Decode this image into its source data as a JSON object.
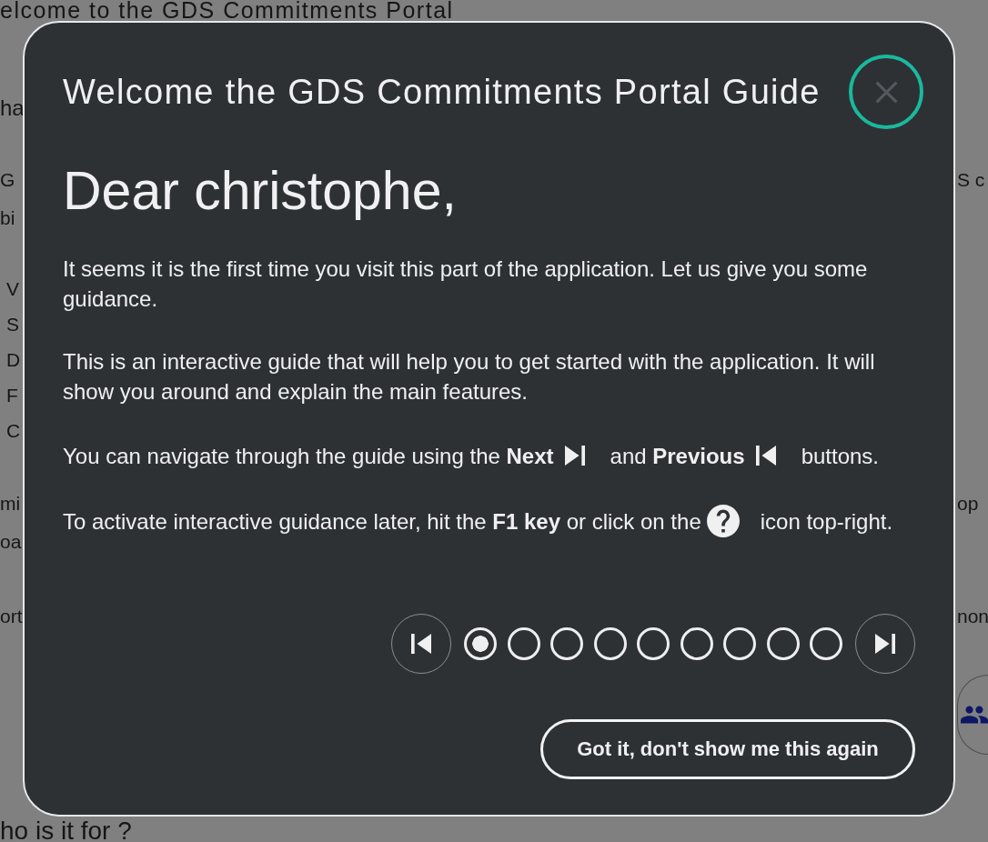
{
  "background_page": {
    "title": "elcome to the GDS Commitments Portal",
    "blocks": [
      {
        "kind": "heading",
        "left": "ha"
      },
      {
        "kind": "paragraph",
        "lines": [
          {
            "left": "G",
            "right": "S c"
          },
          {
            "left": "bi"
          }
        ]
      },
      {
        "kind": "list",
        "items": [
          "V",
          "S",
          "D",
          "F",
          "C"
        ]
      },
      {
        "kind": "paragraph",
        "lines": [
          {
            "left": "mi",
            "right": "op"
          },
          {
            "left": "oa"
          }
        ]
      },
      {
        "kind": "paragraph",
        "lines": [
          {
            "left": "ort",
            "right": "non"
          }
        ]
      },
      {
        "kind": "button"
      },
      {
        "kind": "heading",
        "left": "ho is it for ?"
      }
    ]
  },
  "guide": {
    "title": "Welcome the GDS Commitments Portal Guide",
    "greeting": "Dear christophe,",
    "paragraphs": [
      {
        "parts": [
          {
            "kind": "text",
            "text": "It seems it is the first time you visit this part of the application. Let us give you some guidance."
          }
        ]
      },
      {
        "parts": [
          {
            "kind": "text",
            "text": "This is an interactive guide that will help you to get started with the application. It will show you around and explain the main features."
          }
        ]
      },
      {
        "parts": [
          {
            "kind": "text",
            "text": "You can navigate through the guide using the **Next**"
          },
          {
            "kind": "next"
          },
          {
            "kind": "text",
            "text": "and **Previous**"
          },
          {
            "kind": "previous"
          },
          {
            "kind": "text",
            "text": "buttons."
          }
        ]
      },
      {
        "parts": [
          {
            "kind": "text",
            "text": "To activate interactive guidance later, hit the **F1 key** or click on the"
          },
          {
            "kind": "help"
          },
          {
            "kind": "text",
            "text": "icon top-right."
          }
        ]
      }
    ],
    "steps": [
      {
        "selected": true
      },
      {
        "selected": false
      },
      {
        "selected": false
      },
      {
        "selected": false
      },
      {
        "selected": false
      },
      {
        "selected": false
      },
      {
        "selected": false
      },
      {
        "selected": false
      },
      {
        "selected": false
      }
    ],
    "dismiss_button": "Got it, don't show me this again"
  }
}
